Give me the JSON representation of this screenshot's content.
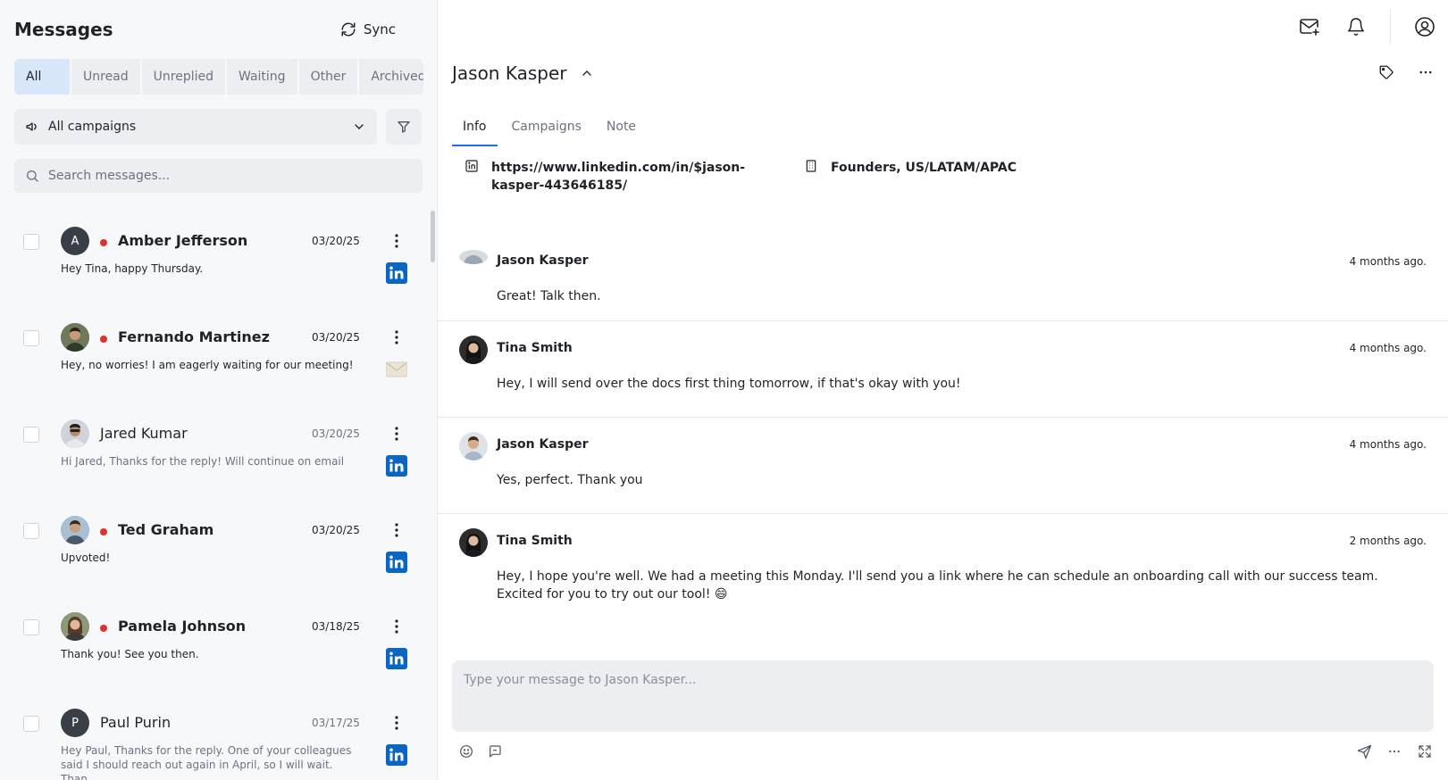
{
  "left_panel": {
    "title": "Messages",
    "sync_label": "Sync",
    "filters": [
      "All",
      "Unread",
      "Unreplied",
      "Waiting",
      "Other",
      "Archived"
    ],
    "campaign_select": "All campaigns",
    "search_placeholder": "Search messages..."
  },
  "conversations": [
    {
      "name": "Amber Jefferson",
      "date": "03/20/25",
      "preview": "Hey Tina, happy Thursday.",
      "unread": true,
      "avatar_initial": "A",
      "channel": "linkedin-icon"
    },
    {
      "name": "Fernando Martinez",
      "date": "03/20/25",
      "preview": "Hey, no worries! I am eagerly waiting for our meeting!",
      "unread": true,
      "avatar_initial": "",
      "channel": "email-icon"
    },
    {
      "name": "Jared Kumar",
      "date": "03/20/25",
      "preview": "Hi Jared, Thanks for the reply! Will continue on email",
      "unread": false,
      "avatar_initial": "",
      "channel": "linkedin-icon"
    },
    {
      "name": "Ted Graham",
      "date": "03/20/25",
      "preview": "Upvoted!",
      "unread": true,
      "avatar_initial": "",
      "channel": "linkedin-icon"
    },
    {
      "name": "Pamela Johnson",
      "date": "03/18/25",
      "preview": "Thank you!  See you then.",
      "unread": true,
      "avatar_initial": "",
      "channel": "linkedin-icon"
    },
    {
      "name": "Paul Purin",
      "date": "03/17/25",
      "preview": "Hey Paul, Thanks for the reply. One of your colleagues said I should reach out again in April, so I will wait. Than...",
      "unread": false,
      "avatar_initial": "P",
      "channel": "linkedin-icon"
    }
  ],
  "contact": {
    "name": "Jason Kasper",
    "tabs": [
      "Info",
      "Campaigns",
      "Note"
    ],
    "linkedin_url": "https://www.linkedin.com/in/$jason-kasper-443646185/",
    "company": "Founders, US/LATAM/APAC"
  },
  "messages": [
    {
      "sender": "Jason Kasper",
      "time": "4 months ago.",
      "text": "Great! Talk then."
    },
    {
      "sender": "Tina Smith",
      "time": "4 months ago.",
      "text": "Hey, I will send over the docs first thing tomorrow, if that's okay with you!"
    },
    {
      "sender": "Jason Kasper",
      "time": "4 months ago.",
      "text": "Yes, perfect. Thank you"
    },
    {
      "sender": "Tina Smith",
      "time": "2 months ago.",
      "text": "Hey, I hope you're well. We had a meeting this Monday. I'll send you a link where he can schedule an onboarding call with our success team. Excited for you to try out our tool! 😄"
    }
  ],
  "composer": {
    "placeholder": "Type your message to Jason Kasper..."
  },
  "colors": {
    "accent": "#1f6feb",
    "unread_dot": "#e03131",
    "linkedin": "#0a66c2",
    "active_filter": "#d9e7fb"
  }
}
